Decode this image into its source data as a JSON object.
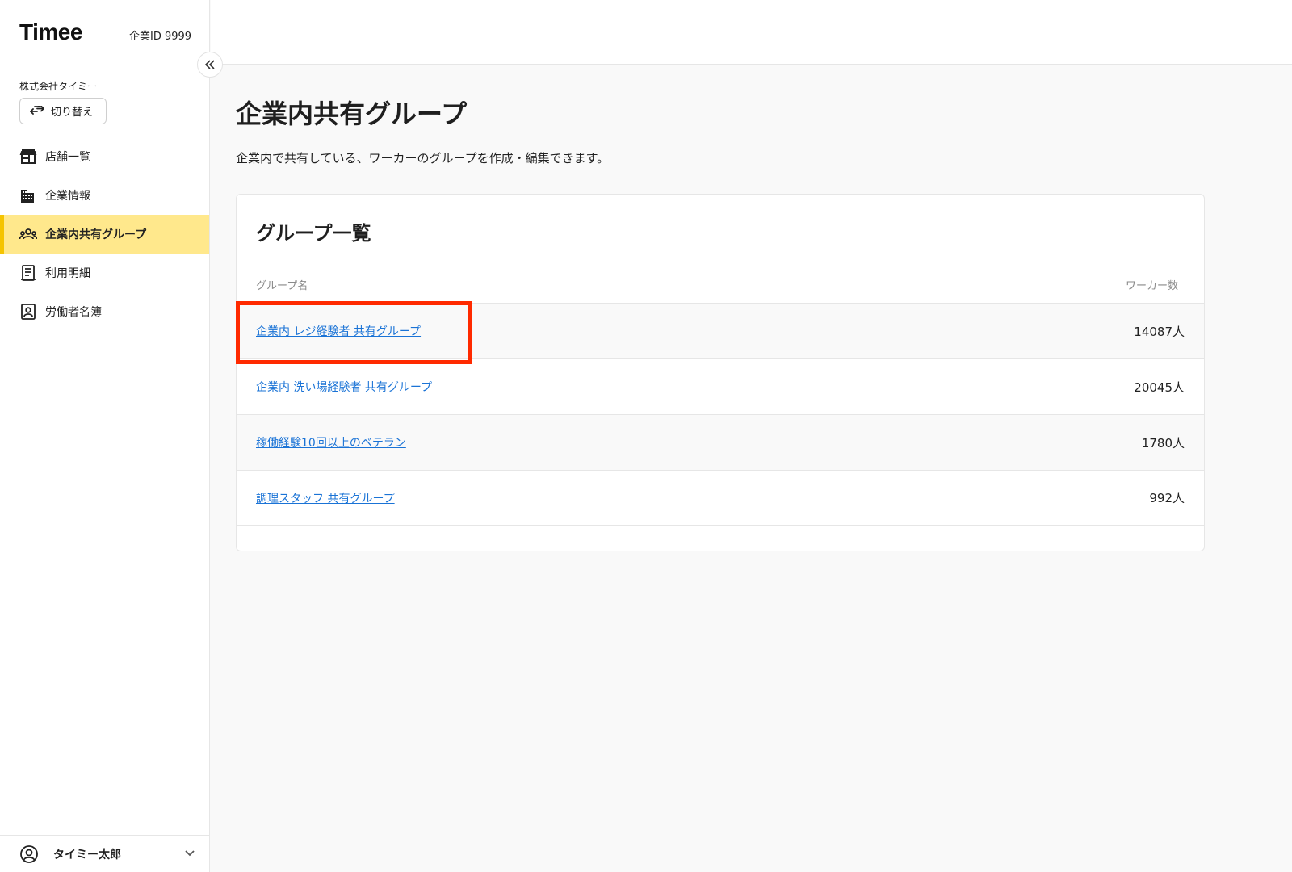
{
  "sidebar": {
    "logo": "Timee",
    "company_id": "企業ID 9999",
    "company_name": "株式会社タイミー",
    "switch_label": "切り替え",
    "items": [
      {
        "label": "店舗一覧",
        "icon": "store-icon"
      },
      {
        "label": "企業情報",
        "icon": "building-icon"
      },
      {
        "label": "企業内共有グループ",
        "icon": "group-icon",
        "active": true
      },
      {
        "label": "利用明細",
        "icon": "receipt-icon"
      },
      {
        "label": "労働者名簿",
        "icon": "contact-book-icon"
      }
    ],
    "user_name": "タイミー太郎"
  },
  "main": {
    "title": "企業内共有グループ",
    "description": "企業内で共有している、ワーカーのグループを作成・編集できます。",
    "card": {
      "title": "グループ一覧",
      "columns": {
        "name": "グループ名",
        "count": "ワーカー数"
      },
      "rows": [
        {
          "name": "企業内 レジ経験者 共有グループ",
          "count": "14087人"
        },
        {
          "name": "企業内 洗い場経験者 共有グループ",
          "count": "20045人"
        },
        {
          "name": "稼働経験10回以上のベテラン",
          "count": "1780人"
        },
        {
          "name": "調理スタッフ 共有グループ",
          "count": "992人"
        }
      ]
    }
  },
  "colors": {
    "accent": "#ffe88c",
    "accent_border": "#f5c400",
    "link": "#1a73d6",
    "highlight": "#ff2a00"
  }
}
